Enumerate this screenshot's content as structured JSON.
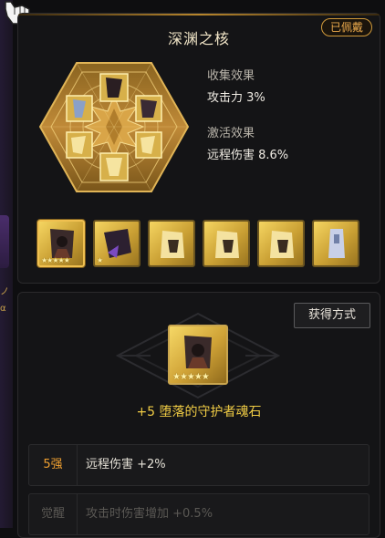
{
  "set": {
    "title": "深渊之核",
    "equipped_badge": "已佩戴",
    "collect_label": "收集效果",
    "collect_value": "攻击力 3%",
    "activate_label": "激活效果",
    "activate_value": "远程伤害 8.6%"
  },
  "stones": [
    {
      "name": "stone-1",
      "stars": "★★★★★",
      "selected": true
    },
    {
      "name": "stone-2",
      "stars": "★",
      "selected": false
    },
    {
      "name": "stone-3",
      "stars": "",
      "selected": false
    },
    {
      "name": "stone-4",
      "stars": "",
      "selected": false
    },
    {
      "name": "stone-5",
      "stars": "",
      "selected": false
    },
    {
      "name": "stone-6",
      "stars": "",
      "selected": false
    }
  ],
  "detail": {
    "acquire_button": "获得方式",
    "big_stars": "★★★★★",
    "stone_name": "+5 堕落的守护者魂石",
    "rows": [
      {
        "level": "5强",
        "text": "远程伤害 +2%"
      },
      {
        "level": "觉醒",
        "text": "攻击时伤害增加 +0.5%"
      }
    ]
  },
  "colors": {
    "gold": "#f0cc45",
    "badge": "#e8a84b",
    "background": "#0e0e10"
  }
}
